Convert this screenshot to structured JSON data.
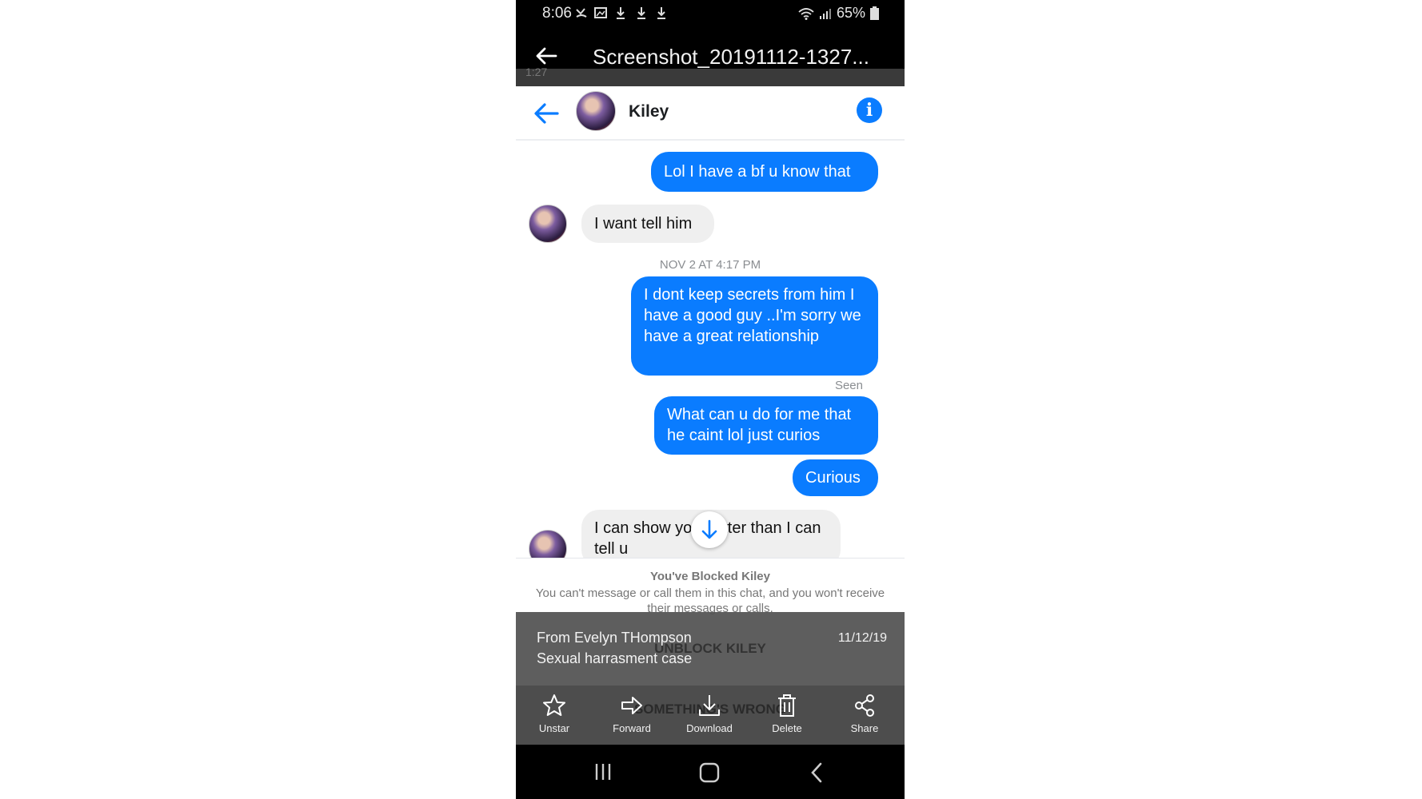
{
  "status_bar": {
    "time": "8:06",
    "battery": "65%"
  },
  "gallery": {
    "title": "Screenshot_20191112-1327...",
    "ghost_time": "1:27"
  },
  "conversation": {
    "contact_name": "Kiley",
    "messages": [
      {
        "direction": "out",
        "text": "Lol I have a bf u know that"
      },
      {
        "direction": "in",
        "text": "I want tell him"
      },
      {
        "direction": "out",
        "text": "I dont keep secrets from him I have a good guy ..I'm sorry we have a great relationship"
      },
      {
        "direction": "out",
        "text": "What can u do for me that he caint lol just curios"
      },
      {
        "direction": "out",
        "text": "Curious"
      },
      {
        "direction": "in",
        "text": "I can show you better than I can tell u"
      }
    ],
    "timestamp": "NOV 2 AT 4:17 PM",
    "seen_label": "Seen"
  },
  "blocked": {
    "title": "You've Blocked Kiley",
    "text": "You can't message or call them in this chat, and you won't receive their messages or calls.",
    "unblock_label": "UNBLOCK KILEY",
    "report_label": "SOMETHING'S WRONG"
  },
  "details": {
    "from": "From Evelyn THompson",
    "subject": "Sexual harrasment case",
    "date": "11/12/19"
  },
  "toolbar": {
    "unstar": "Unstar",
    "forward": "Forward",
    "download": "Download",
    "delete": "Delete",
    "share": "Share"
  },
  "colors": {
    "messenger_blue": "#0a7cff",
    "incoming_bubble": "#efefef"
  }
}
